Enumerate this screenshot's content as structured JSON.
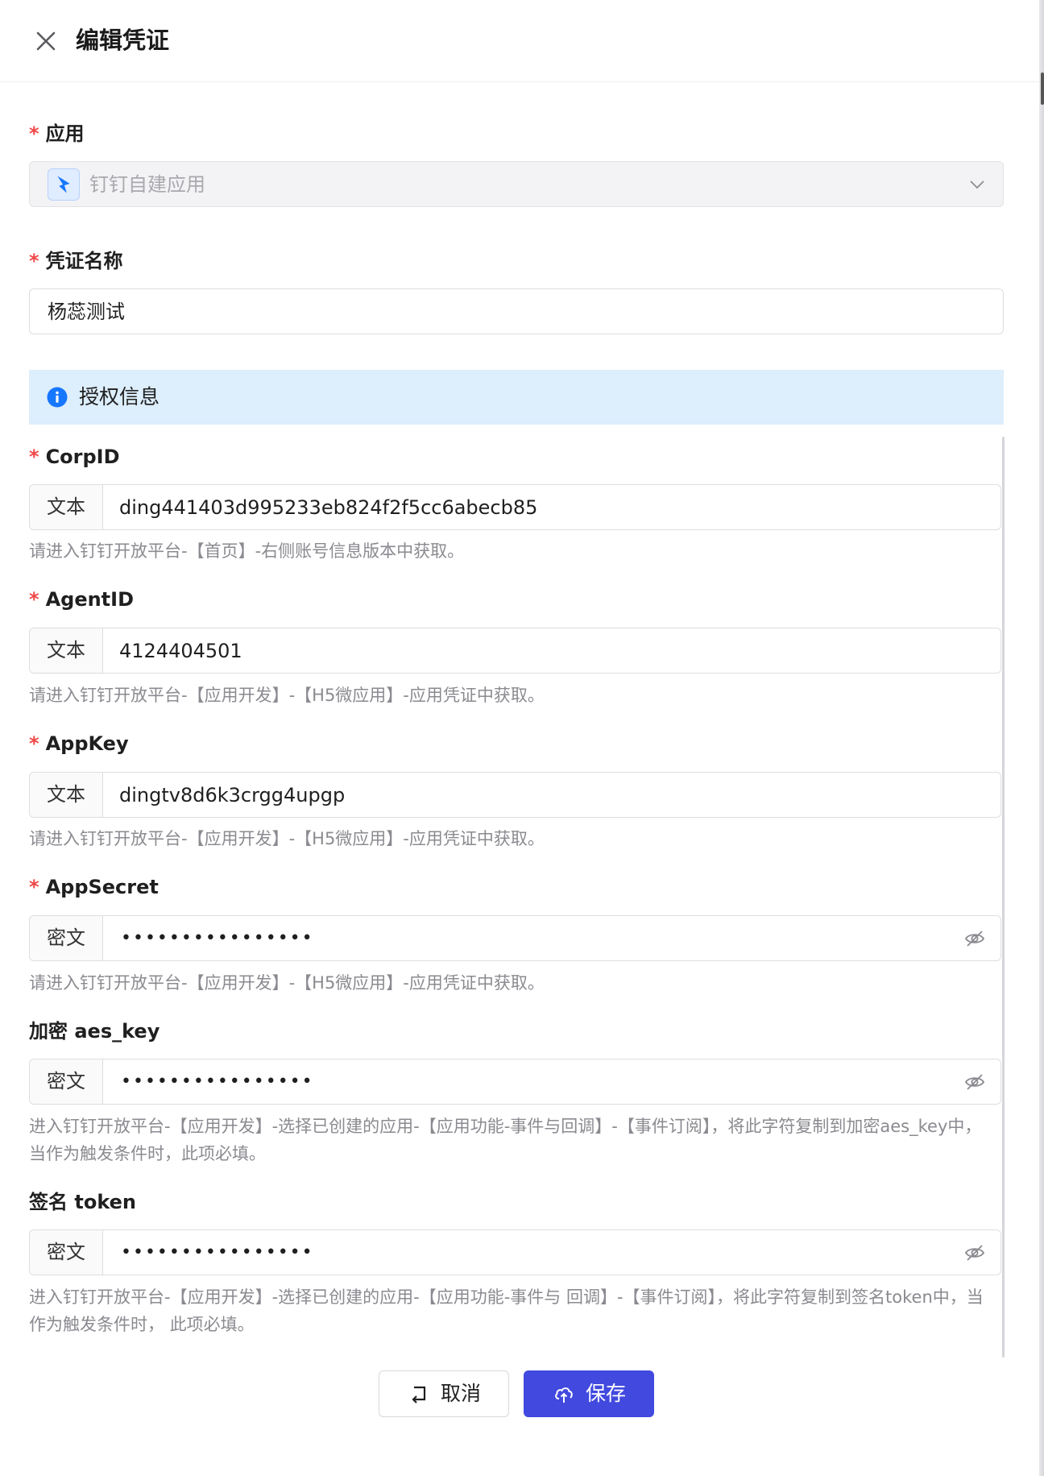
{
  "header": {
    "title": "编辑凭证"
  },
  "app_field": {
    "label": "应用",
    "value": "钉钉自建应用"
  },
  "name_field": {
    "label": "凭证名称",
    "value": "杨蕊测试"
  },
  "info_bar": {
    "text": "授权信息"
  },
  "fields": [
    {
      "label": "CorpID",
      "required": true,
      "prefix": "文本",
      "value": "ding441403d995233eb824f2f5cc6abecb85",
      "masked": false,
      "hint": "请进入钉钉开放平台-【首页】-右侧账号信息版本中获取。"
    },
    {
      "label": "AgentID",
      "required": true,
      "prefix": "文本",
      "value": "4124404501",
      "masked": false,
      "hint": "请进入钉钉开放平台-【应用开发】-【H5微应用】-应用凭证中获取。"
    },
    {
      "label": "AppKey",
      "required": true,
      "prefix": "文本",
      "value": "dingtv8d6k3crgg4upgp",
      "masked": false,
      "hint": "请进入钉钉开放平台-【应用开发】-【H5微应用】-应用凭证中获取。"
    },
    {
      "label": "AppSecret",
      "required": true,
      "prefix": "密文",
      "value": "••••••••••••••••",
      "masked": true,
      "hint": "请进入钉钉开放平台-【应用开发】-【H5微应用】-应用凭证中获取。"
    },
    {
      "label": "加密 aes_key",
      "required": false,
      "prefix": "密文",
      "value": "••••••••••••••••",
      "masked": true,
      "hint": "进入钉钉开放平台-【应用开发】-选择已创建的应用-【应用功能-事件与回调】-【事件订阅】，将此字符复制到加密aes_key中，当作为触发条件时，此项必填。"
    },
    {
      "label": "签名 token",
      "required": false,
      "prefix": "密文",
      "value": "••••••••••••••••",
      "masked": true,
      "hint": "进入钉钉开放平台-【应用开发】-选择已创建的应用-【应用功能-事件与 回调】-【事件订阅】，将此字符复制到签名token中，当作为触发条件时， 此项必填。"
    }
  ],
  "footer": {
    "cancel_label": "取消",
    "save_label": "保存"
  },
  "colors": {
    "primary": "#4149df",
    "required": "#f04848",
    "info_bg": "#ddeefc",
    "info_icon": "#1677ff"
  },
  "icons": {
    "close": "close-icon",
    "app": "dingtalk-icon",
    "select": "chevron-down-icon",
    "info": "info-icon",
    "eye": "eye-off-icon",
    "cancel": "undo-icon",
    "save": "cloud-upload-icon"
  }
}
